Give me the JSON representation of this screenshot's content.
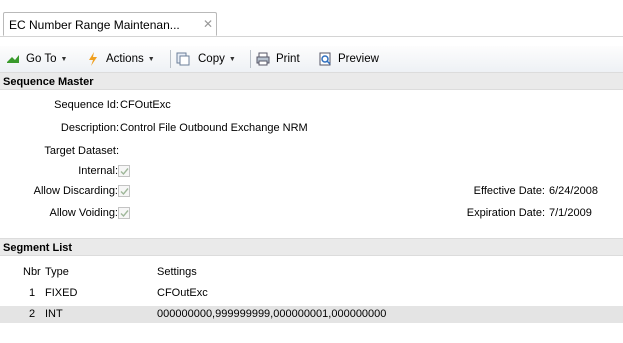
{
  "tab": {
    "label": "EC Number Range Maintenan...",
    "close": "✕"
  },
  "toolbar": {
    "goto_label": "Go To",
    "actions_label": "Actions",
    "copy_label": "Copy",
    "print_label": "Print",
    "preview_label": "Preview"
  },
  "sequence_master": {
    "header": "Sequence Master",
    "fields": {
      "sequence_id_label": "Sequence Id:",
      "sequence_id_value": "CFOutExc",
      "description_label": "Description:",
      "description_value": "Control File Outbound Exchange NRM",
      "target_dataset_label": "Target Dataset:",
      "target_dataset_value": "",
      "internal_label": "Internal:",
      "internal_checked": true,
      "allow_discarding_label": "Allow Discarding:",
      "allow_discarding_checked": true,
      "allow_voiding_label": "Allow Voiding:",
      "allow_voiding_checked": true,
      "effective_date_label": "Effective Date:",
      "effective_date_value": "6/24/2008",
      "expiration_date_label": "Expiration Date:",
      "expiration_date_value": "7/1/2009"
    }
  },
  "segment_list": {
    "header": "Segment List",
    "columns": [
      "Nbr",
      "Type",
      "Settings"
    ],
    "rows": [
      {
        "nbr": "1",
        "type": "FIXED",
        "settings": "CFOutExc"
      },
      {
        "nbr": "2",
        "type": "INT",
        "settings": "000000000,999999999,000000001,000000000"
      }
    ]
  },
  "colors": {
    "accent_green": "#3a9a2c",
    "header_bg": "#eaeaea",
    "selected_row": "#e4e4e4"
  }
}
